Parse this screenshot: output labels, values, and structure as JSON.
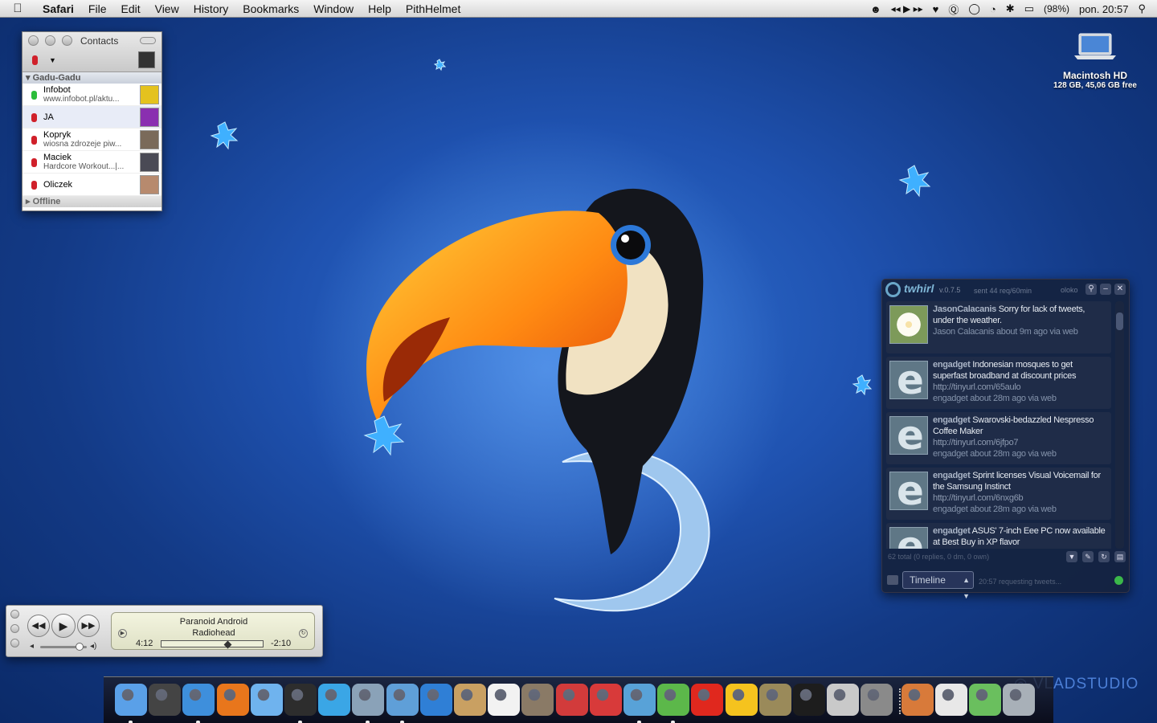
{
  "menubar": {
    "apple_icon": "apple-logo",
    "app_name": "Safari",
    "menus": [
      "File",
      "Edit",
      "View",
      "History",
      "Bookmarks",
      "Window",
      "Help",
      "PithHelmet"
    ],
    "battery": "(98%)",
    "clock": "pon. 20:57"
  },
  "desktop": {
    "drive_name": "Macintosh HD",
    "drive_info": "128 GB, 45,06 GB free",
    "watermark": "VLADSTUDIO"
  },
  "contacts": {
    "title": "Contacts",
    "group_label": "Gadu-Gadu",
    "offline_label": "Offline",
    "entries": [
      {
        "name": "Infobot",
        "status_text": "www.infobot.pl/aktu...",
        "status_color": "#2bbd3a",
        "avatar_color": "#e4c21e"
      },
      {
        "name": "JA",
        "status_text": "",
        "status_color": "#d0202a",
        "avatar_color": "#8a2fb0"
      },
      {
        "name": "Kopryk",
        "status_text": "wiosna zdrozeje piw...",
        "status_color": "#d0202a",
        "avatar_color": "#7a6a5a"
      },
      {
        "name": "Maciek",
        "status_text": "Hardcore Workout...|...",
        "status_color": "#d0202a",
        "avatar_color": "#4a4a55"
      },
      {
        "name": "Oliczek",
        "status_text": "",
        "status_color": "#d0202a",
        "avatar_color": "#b78a6e"
      }
    ]
  },
  "twhirl": {
    "app_name": "twhirl",
    "version": "v.0.7.5",
    "rate": "sent 44 req/60min",
    "user": "oloko",
    "tweets": [
      {
        "user": "JasonCalacanis",
        "text": "Sorry for lack of tweets, under the weather.",
        "link": "",
        "meta": "Jason Calacanis about 9m ago via web",
        "avatar": "flower"
      },
      {
        "user": "engadget",
        "text": "Indonesian mosques to get superfast broadband at discount prices",
        "link": "http://tinyurl.com/65aulo",
        "meta": "engadget about 28m ago via web",
        "avatar": "e"
      },
      {
        "user": "engadget",
        "text": "Swarovski-bedazzled Nespresso Coffee Maker",
        "link": "http://tinyurl.com/6jfpo7",
        "meta": "engadget about 28m ago via web",
        "avatar": "e"
      },
      {
        "user": "engadget",
        "text": "Sprint licenses Visual Voicemail for the Samsung Instinct",
        "link": "http://tinyurl.com/6nxg6b",
        "meta": "engadget about 28m ago via web",
        "avatar": "e"
      },
      {
        "user": "engadget",
        "text": "ASUS' 7-inch Eee PC now available at Best Buy in XP flavor",
        "link": "",
        "meta": "",
        "avatar": "e"
      }
    ],
    "total_status": "62 total (0 replies, 0 dm, 0 own)",
    "timeline_select": "Timeline",
    "request_status": "20:57 requesting tweets..."
  },
  "itunes": {
    "song": "Paranoid Android",
    "artist": "Radiohead",
    "elapsed": "4:12",
    "remaining": "-2:10",
    "progress": 0.66,
    "volume": 0.85
  },
  "dock": {
    "icons": [
      {
        "name": "finder",
        "color": "#5aa0e8",
        "running": true
      },
      {
        "name": "dashboard",
        "color": "#444444",
        "running": false
      },
      {
        "name": "safari",
        "color": "#3e8fdc",
        "running": true
      },
      {
        "name": "firefox",
        "color": "#e8761c",
        "running": false
      },
      {
        "name": "ichat",
        "color": "#6fb3ee",
        "running": false
      },
      {
        "name": "adium",
        "color": "#2d2d2d",
        "running": true
      },
      {
        "name": "skype",
        "color": "#3aa6e6",
        "running": false
      },
      {
        "name": "mail",
        "color": "#8aa2b8",
        "running": true
      },
      {
        "name": "itunes",
        "color": "#5f9fd8",
        "running": true
      },
      {
        "name": "quicktime",
        "color": "#2f7fd6",
        "running": false
      },
      {
        "name": "address-book",
        "color": "#c9a062",
        "running": false
      },
      {
        "name": "ical",
        "color": "#f2f2f2",
        "running": false
      },
      {
        "name": "iphoto",
        "color": "#8a7a66",
        "running": false
      },
      {
        "name": "transmit",
        "color": "#d23b3b",
        "running": false
      },
      {
        "name": "garageband",
        "color": "#d83a3a",
        "running": false
      },
      {
        "name": "network-utility",
        "color": "#58a2d8",
        "running": true
      },
      {
        "name": "sync",
        "color": "#5cb84a",
        "running": true
      },
      {
        "name": "app-red-flame",
        "color": "#e0281e",
        "running": false
      },
      {
        "name": "cyberduck",
        "color": "#f5c31e",
        "running": false
      },
      {
        "name": "shield-app",
        "color": "#9a8a5a",
        "running": false
      },
      {
        "name": "terminal",
        "color": "#1d1d1d",
        "running": false
      },
      {
        "name": "expose",
        "color": "#c9c9c9",
        "running": false
      },
      {
        "name": "system-preferences",
        "color": "#8a8a8a",
        "running": false
      },
      {
        "name": "stacks-icon",
        "color": "#d87a3a",
        "running": false
      },
      {
        "name": "applications-folder",
        "color": "#e8e8e8",
        "running": false
      },
      {
        "name": "downloads-folder",
        "color": "#6abf5e",
        "running": false
      },
      {
        "name": "trash",
        "color": "#a8b0b8",
        "running": false
      }
    ]
  }
}
